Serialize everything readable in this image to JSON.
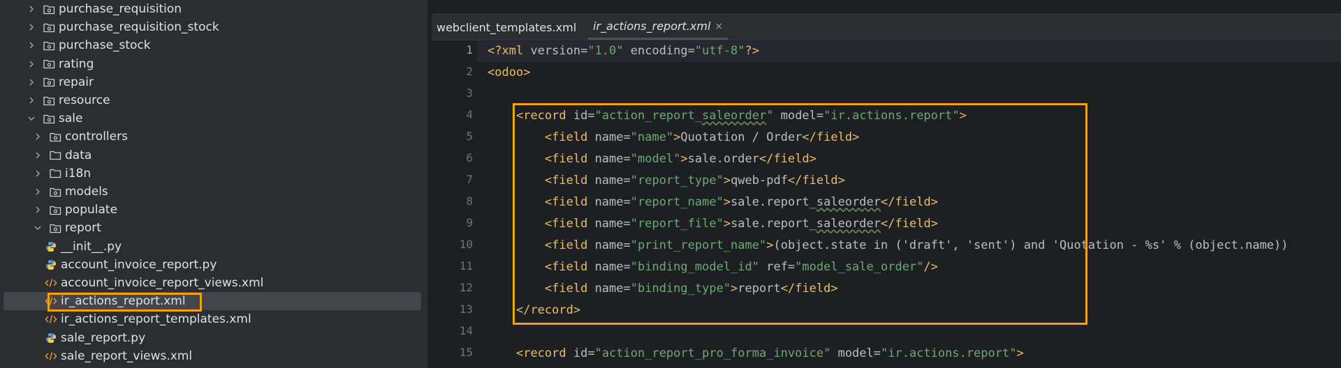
{
  "tree": {
    "items": [
      {
        "label": "purchase_requisition",
        "kind": "pkg",
        "expanded": false
      },
      {
        "label": "purchase_requisition_stock",
        "kind": "pkg",
        "expanded": false
      },
      {
        "label": "purchase_stock",
        "kind": "pkg",
        "expanded": false
      },
      {
        "label": "rating",
        "kind": "pkg",
        "expanded": false
      },
      {
        "label": "repair",
        "kind": "pkg",
        "expanded": false
      },
      {
        "label": "resource",
        "kind": "pkg",
        "expanded": false
      },
      {
        "label": "sale",
        "kind": "pkg",
        "expanded": true
      },
      {
        "label": "controllers",
        "kind": "pkg",
        "expanded": false
      },
      {
        "label": "data",
        "kind": "folder",
        "expanded": false
      },
      {
        "label": "i18n",
        "kind": "folder",
        "expanded": false
      },
      {
        "label": "models",
        "kind": "pkg",
        "expanded": false
      },
      {
        "label": "populate",
        "kind": "pkg",
        "expanded": false
      },
      {
        "label": "report",
        "kind": "pkg",
        "expanded": true
      },
      {
        "label": "__init__.py",
        "kind": "py"
      },
      {
        "label": "account_invoice_report.py",
        "kind": "py"
      },
      {
        "label": "account_invoice_report_views.xml",
        "kind": "xml"
      },
      {
        "label": "ir_actions_report.xml",
        "kind": "xml",
        "selected": true
      },
      {
        "label": "ir_actions_report_templates.xml",
        "kind": "xml"
      },
      {
        "label": "sale_report.py",
        "kind": "py"
      },
      {
        "label": "sale_report_views.xml",
        "kind": "xml"
      }
    ]
  },
  "tabs": [
    {
      "label": "webclient_templates.xml",
      "active": false
    },
    {
      "label": "ir_actions_report.xml",
      "active": true,
      "close": "×"
    }
  ],
  "editor": {
    "line_numbers": [
      "1",
      "2",
      "3",
      "4",
      "5",
      "6",
      "7",
      "8",
      "9",
      "10",
      "11",
      "12",
      "13",
      "14",
      "15"
    ],
    "lines": [
      {
        "indent": "",
        "parts": [
          [
            "p",
            "<?"
          ],
          [
            "t",
            "xml "
          ],
          [
            "a",
            "version="
          ],
          [
            "s",
            "\"1.0\""
          ],
          [
            "a",
            " encoding="
          ],
          [
            "s",
            "\"utf-8\""
          ],
          [
            "p",
            "?>"
          ]
        ]
      },
      {
        "indent": "",
        "parts": [
          [
            "p",
            "<"
          ],
          [
            "t",
            "odoo"
          ],
          [
            "p",
            ">"
          ]
        ]
      },
      {
        "indent": "",
        "parts": []
      },
      {
        "indent": "    ",
        "parts": [
          [
            "p",
            "<"
          ],
          [
            "t",
            "record "
          ],
          [
            "a",
            "id="
          ],
          [
            "s",
            "\"action_report_"
          ],
          [
            "sw",
            "saleorder"
          ],
          [
            "s",
            "\""
          ],
          [
            "a",
            " model="
          ],
          [
            "s",
            "\"ir.actions.report\""
          ],
          [
            "p",
            ">"
          ]
        ]
      },
      {
        "indent": "        ",
        "parts": [
          [
            "p",
            "<"
          ],
          [
            "t",
            "field "
          ],
          [
            "a",
            "name="
          ],
          [
            "s",
            "\"name\""
          ],
          [
            "p",
            ">"
          ],
          [
            "x",
            "Quotation / Order"
          ],
          [
            "p",
            "</"
          ],
          [
            "t",
            "field"
          ],
          [
            "p",
            ">"
          ]
        ]
      },
      {
        "indent": "        ",
        "parts": [
          [
            "p",
            "<"
          ],
          [
            "t",
            "field "
          ],
          [
            "a",
            "name="
          ],
          [
            "s",
            "\"model\""
          ],
          [
            "p",
            ">"
          ],
          [
            "x",
            "sale.order"
          ],
          [
            "p",
            "</"
          ],
          [
            "t",
            "field"
          ],
          [
            "p",
            ">"
          ]
        ]
      },
      {
        "indent": "        ",
        "parts": [
          [
            "p",
            "<"
          ],
          [
            "t",
            "field "
          ],
          [
            "a",
            "name="
          ],
          [
            "s",
            "\"report_type\""
          ],
          [
            "p",
            ">"
          ],
          [
            "x",
            "qweb-pdf"
          ],
          [
            "p",
            "</"
          ],
          [
            "t",
            "field"
          ],
          [
            "p",
            ">"
          ]
        ]
      },
      {
        "indent": "        ",
        "parts": [
          [
            "p",
            "<"
          ],
          [
            "t",
            "field "
          ],
          [
            "a",
            "name="
          ],
          [
            "s",
            "\"report_name\""
          ],
          [
            "p",
            ">"
          ],
          [
            "x",
            "sale.report_"
          ],
          [
            "xw",
            "saleorder"
          ],
          [
            "p",
            "</"
          ],
          [
            "t",
            "field"
          ],
          [
            "p",
            ">"
          ]
        ]
      },
      {
        "indent": "        ",
        "parts": [
          [
            "p",
            "<"
          ],
          [
            "t",
            "field "
          ],
          [
            "a",
            "name="
          ],
          [
            "s",
            "\"report_file\""
          ],
          [
            "p",
            ">"
          ],
          [
            "x",
            "sale.report_"
          ],
          [
            "xw",
            "saleorder"
          ],
          [
            "p",
            "</"
          ],
          [
            "t",
            "field"
          ],
          [
            "p",
            ">"
          ]
        ]
      },
      {
        "indent": "        ",
        "parts": [
          [
            "p",
            "<"
          ],
          [
            "t",
            "field "
          ],
          [
            "a",
            "name="
          ],
          [
            "s",
            "\"print_report_name\""
          ],
          [
            "p",
            ">"
          ],
          [
            "x",
            "(object.state in ('draft', 'sent') and 'Quotation - %s' % (object.name))"
          ]
        ]
      },
      {
        "indent": "        ",
        "parts": [
          [
            "p",
            "<"
          ],
          [
            "t",
            "field "
          ],
          [
            "a",
            "name="
          ],
          [
            "s",
            "\"binding_model_id\""
          ],
          [
            "a",
            " ref="
          ],
          [
            "s",
            "\"model_sale_order\""
          ],
          [
            "p",
            "/>"
          ]
        ]
      },
      {
        "indent": "        ",
        "parts": [
          [
            "p",
            "<"
          ],
          [
            "t",
            "field "
          ],
          [
            "a",
            "name="
          ],
          [
            "s",
            "\"binding_type\""
          ],
          [
            "p",
            ">"
          ],
          [
            "x",
            "report"
          ],
          [
            "p",
            "</"
          ],
          [
            "t",
            "field"
          ],
          [
            "p",
            ">"
          ]
        ]
      },
      {
        "indent": "    ",
        "parts": [
          [
            "p",
            "</"
          ],
          [
            "t",
            "record"
          ],
          [
            "p",
            ">"
          ]
        ]
      },
      {
        "indent": "",
        "parts": []
      },
      {
        "indent": "    ",
        "parts": [
          [
            "p",
            "<"
          ],
          [
            "t",
            "record "
          ],
          [
            "a",
            "id="
          ],
          [
            "s",
            "\"action_report_pro_forma_invoice\""
          ],
          [
            "a",
            " model="
          ],
          [
            "s",
            "\"ir.actions.report\""
          ],
          [
            "p",
            ">"
          ]
        ]
      }
    ]
  },
  "colors": {
    "accent_highlight": "#f0a30a",
    "tag": "#e8bf6a",
    "string": "#6aab73",
    "text": "#bcbec4"
  }
}
